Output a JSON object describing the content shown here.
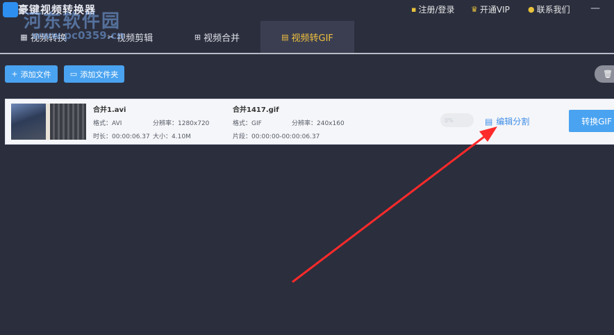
{
  "app": {
    "title": "豪键视频转换器",
    "watermark": "河东软件园",
    "watermark_url": "www.pc0359.cn"
  },
  "topbar": {
    "register_login": "注册/登录",
    "vip": "开通VIP",
    "contact": "联系我们",
    "minimize": "—"
  },
  "tabs": [
    {
      "label": "视频转换",
      "icon": "▦",
      "active": false
    },
    {
      "label": "视频剪辑",
      "icon": "✂",
      "active": false
    },
    {
      "label": "视频合并",
      "icon": "⊞",
      "active": false
    },
    {
      "label": "视频转GIF",
      "icon": "▤",
      "active": true
    }
  ],
  "toolbar": {
    "add_file": "添加文件",
    "add_folder": "添加文件夹",
    "add_file_icon": "+",
    "add_folder_icon": "▭",
    "right_icon": "🗑"
  },
  "file": {
    "source_name": "合并1.avi",
    "source_format": "格式：AVI",
    "source_resolution": "分辨率：1280x720",
    "source_duration": "时长：00:00:06.37",
    "source_size": "大小：4.10M",
    "output_name": "合并1417.gif",
    "output_format": "格式：GIF",
    "output_resolution": "分辨率：240x160",
    "output_segment": "片段：00:00:00-00:00:06.37",
    "progress": "0%",
    "edit_split": "编辑分割",
    "convert": "转换GIF"
  },
  "colors": {
    "background": "#2b2e3d",
    "accent": "#4aa3f0",
    "active_tab_text": "#f0c040",
    "arrow": "#ff2a2a"
  }
}
